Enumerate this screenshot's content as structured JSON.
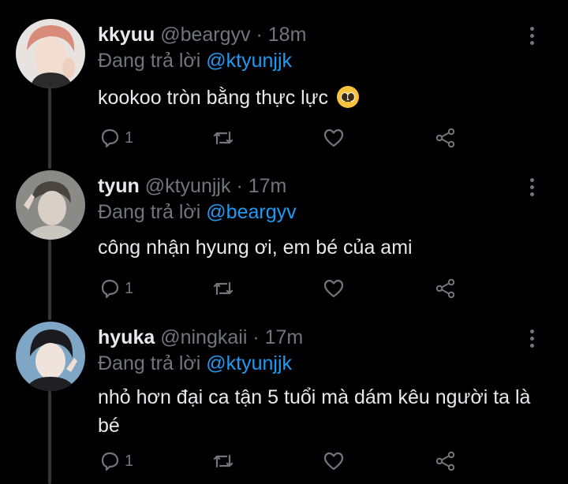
{
  "tweets": [
    {
      "name": "kkyuu",
      "handle": "@beargyv",
      "dot": "·",
      "time": "18m",
      "reply_prefix": "Đang trả lời",
      "reply_to": "@ktyunjjk",
      "text": "kookoo tròn bằng thực lực",
      "emoji": "pleading-face",
      "reply_count": "1"
    },
    {
      "name": "tyun",
      "handle": "@ktyunjjk",
      "dot": "·",
      "time": "17m",
      "reply_prefix": "Đang trả lời",
      "reply_to": "@beargyv",
      "text": "công nhận hyung ơi, em bé của ami",
      "reply_count": "1"
    },
    {
      "name": "hyuka",
      "handle": "@ningkaii",
      "dot": "·",
      "time": "17m",
      "reply_prefix": "Đang trả lời",
      "reply_to": "@ktyunjjk",
      "text": "nhỏ hơn đại ca tận 5 tuổi mà dám kêu người ta là bé",
      "reply_count": "1"
    }
  ],
  "icons": [
    "reply-icon",
    "retweet-icon",
    "like-icon",
    "share-icon",
    "more-icon"
  ],
  "colors": {
    "background": "#000000",
    "text": "#e7e9ea",
    "muted": "#71767b",
    "link": "#1d9bf0",
    "thread_line": "#333639"
  }
}
